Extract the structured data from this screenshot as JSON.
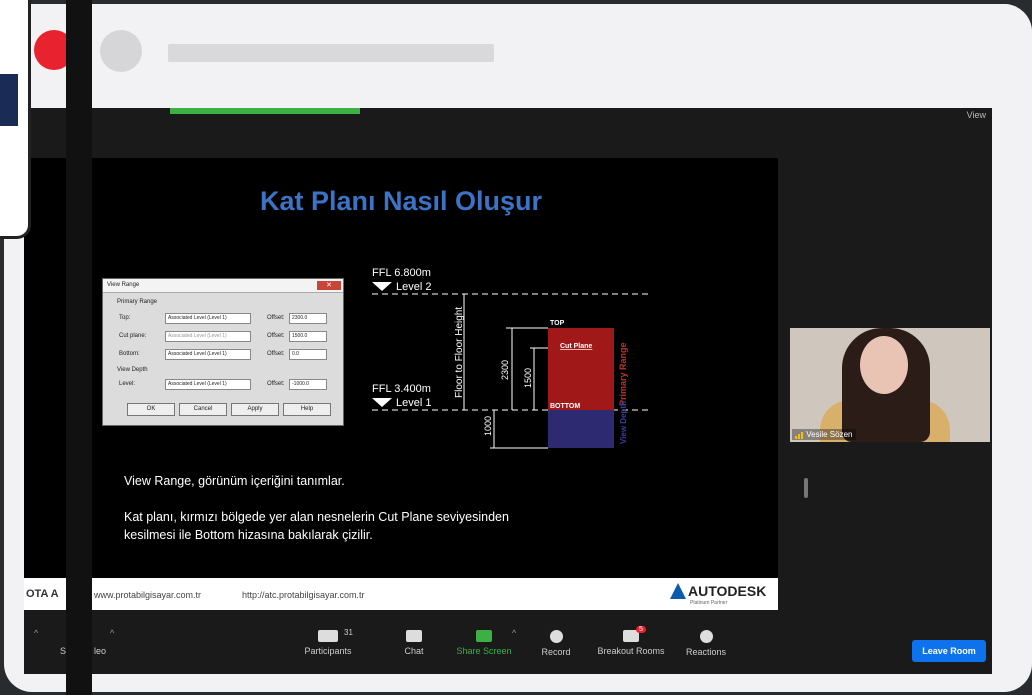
{
  "meeting": {
    "view_label": "View",
    "slide_title": "Kat Planı Nasıl Oluşur",
    "dialog": {
      "title": "View Range",
      "primary_range": "Primary Range",
      "rows": [
        {
          "label": "Top:",
          "combo": "Associated Level (Level 1)",
          "offset_label": "Offset:",
          "offset": "2300.0"
        },
        {
          "label": "Cut plane:",
          "combo": "Associated Level (Level 1)",
          "offset_label": "Offset:",
          "offset": "1500.0"
        },
        {
          "label": "Bottom:",
          "combo": "Associated Level (Level 1)",
          "offset_label": "Offset:",
          "offset": "0.0"
        }
      ],
      "view_depth": "View Depth",
      "level_row": {
        "label": "Level:",
        "combo": "Associated Level (Level 1)",
        "offset_label": "Offset:",
        "offset": "-1000.0"
      },
      "buttons": [
        "OK",
        "Cancel",
        "Apply",
        "Help"
      ]
    },
    "diagram": {
      "ffl_top": "FFL 6.800m",
      "level2": "Level 2",
      "ffl_bottom": "FFL 3.400m",
      "level1": "Level 1",
      "floor_height": "Floor to Floor Height",
      "dim_2300": "2300",
      "dim_1500": "1500",
      "dim_1000": "1000",
      "top": "TOP",
      "cut_plane": "Cut Plane",
      "bottom": "BOTTOM",
      "primary_range": "Primary Range",
      "view_depth": "View Depth"
    },
    "text1": "View Range, görünüm içeriğini tanımlar.",
    "text2": "Kat planı, kırmızı bölgede yer alan  nesnelerin Cut Plane seviyesinden",
    "text3": "kesilmesi ile Bottom hizasına bakılarak çizilir.",
    "footer": {
      "brand": "OTA A",
      "link1": "www.protabilgisayar.com.tr",
      "link2": "http://atc.protabilgisayar.com.tr",
      "autodesk": "AUTODESK",
      "partner": "Platinum Partner"
    },
    "participant_name": "Vesile Sözen",
    "toolbar": {
      "items": [
        {
          "label": "Participants",
          "count": "31"
        },
        {
          "label": "Chat"
        },
        {
          "label": "Share Screen"
        },
        {
          "label": "Record"
        },
        {
          "label": "Breakout Rooms",
          "badge": "5"
        },
        {
          "label": "Reactions"
        }
      ],
      "left_partial1": "St",
      "left_partial2": "leo",
      "leave": "Leave Room"
    }
  }
}
